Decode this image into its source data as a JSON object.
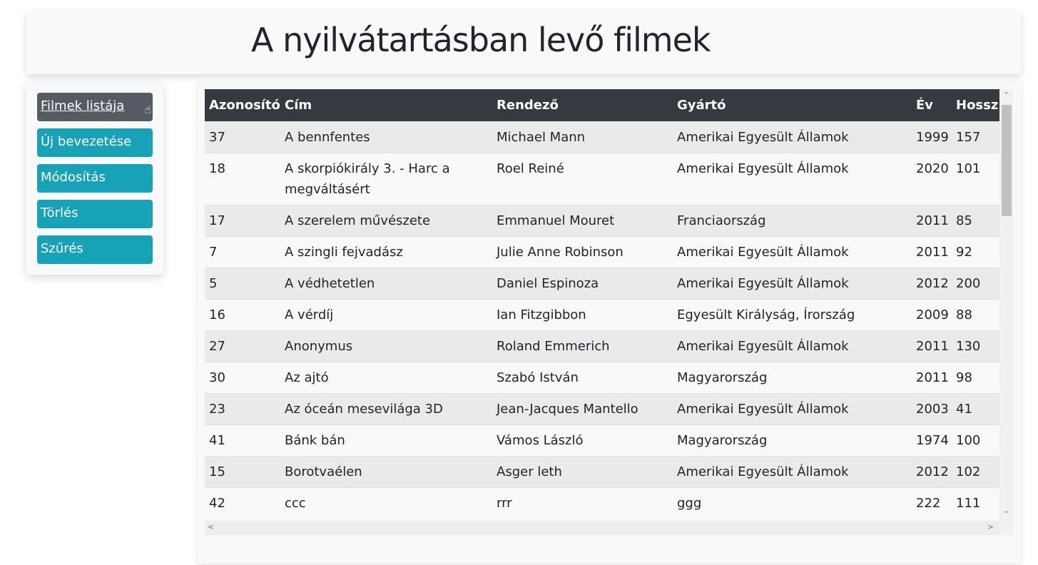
{
  "header": {
    "title": "A nyilvátartásban levő filmek"
  },
  "sidebar": {
    "items": [
      {
        "label": "Filmek listája",
        "active": true
      },
      {
        "label": "Új bevezetése"
      },
      {
        "label": "Módosítás"
      },
      {
        "label": "Törlés"
      },
      {
        "label": "Szűrés"
      }
    ]
  },
  "table": {
    "columns": [
      "Azonosító",
      "Cím",
      "Rendező",
      "Gyártó",
      "Év",
      "Hossz"
    ],
    "rows": [
      [
        "37",
        "A bennfentes",
        "Michael Mann",
        "Amerikai Egyesült Államok",
        "1999",
        "157"
      ],
      [
        "18",
        "A skorpiókirály 3. - Harc a megváltásért",
        "Roel Reiné",
        "Amerikai Egyesült Államok",
        "2020",
        "101"
      ],
      [
        "17",
        "A szerelem művészete",
        "Emmanuel Mouret",
        "Franciaország",
        "2011",
        "85"
      ],
      [
        "7",
        "A szingli fejvadász",
        "Julie Anne Robinson",
        "Amerikai Egyesült Államok",
        "2011",
        "92"
      ],
      [
        "5",
        "A védhetetlen",
        "Daniel Espinoza",
        "Amerikai Egyesült Államok",
        "2012",
        "200"
      ],
      [
        "16",
        "A vérdíj",
        "Ian Fitzgibbon",
        "Egyesült Királyság, Írország",
        "2009",
        "88"
      ],
      [
        "27",
        "Anonymus",
        "Roland Emmerich",
        "Amerikai Egyesült Államok",
        "2011",
        "130"
      ],
      [
        "30",
        "Az ajtó",
        "Szabó István",
        "Magyarország",
        "2011",
        "98"
      ],
      [
        "23",
        "Az óceán mesevilága 3D",
        "Jean-Jacques Mantello",
        "Amerikai Egyesült Államok",
        "2003",
        "41"
      ],
      [
        "41",
        "Bánk bán",
        "Vámos László",
        "Magyarország",
        "1974",
        "100"
      ],
      [
        "15",
        "Borotvaélen",
        "Asger leth",
        "Amerikai Egyesült Államok",
        "2012",
        "102"
      ],
      [
        "42",
        "ccc",
        "rrr",
        "ggg",
        "222",
        "111"
      ]
    ]
  }
}
